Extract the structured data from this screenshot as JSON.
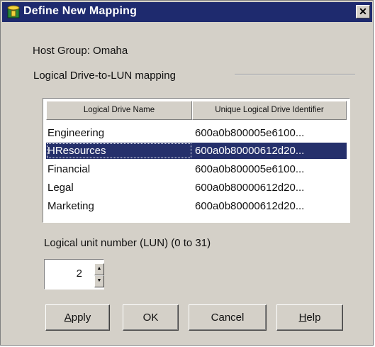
{
  "window": {
    "title": "Define New Mapping",
    "close_glyph": "✕"
  },
  "host_group_label": "Host Group: Omaha",
  "mapping_group_label": "Logical Drive-to-LUN mapping",
  "table": {
    "columns": [
      "Logical Drive Name",
      "Unique Logical Drive Identifier"
    ],
    "rows": [
      {
        "name": "Engineering",
        "id": "600a0b800005e6100..."
      },
      {
        "name": "HResources",
        "id": "600a0b80000612d20...",
        "selected": true
      },
      {
        "name": "Financial",
        "id": "600a0b800005e6100..."
      },
      {
        "name": "Legal",
        "id": "600a0b80000612d20..."
      },
      {
        "name": "Marketing",
        "id": "600a0b80000612d20..."
      }
    ]
  },
  "lun_label": "Logical unit number (LUN) (0 to 31)",
  "lun_value": "2",
  "buttons": {
    "apply": {
      "mnemonic": "A",
      "rest": "pply"
    },
    "ok": "OK",
    "cancel": "Cancel",
    "help": {
      "mnemonic": "H",
      "rest": "elp"
    }
  },
  "icons": {
    "title_icon": "database-cylinder-icon",
    "spin_up": "spin-up-arrow-icon",
    "spin_down": "spin-down-arrow-icon"
  },
  "colors": {
    "titlebar": "#1e2a6e",
    "selection": "#25306b",
    "face": "#d4d0c8"
  }
}
